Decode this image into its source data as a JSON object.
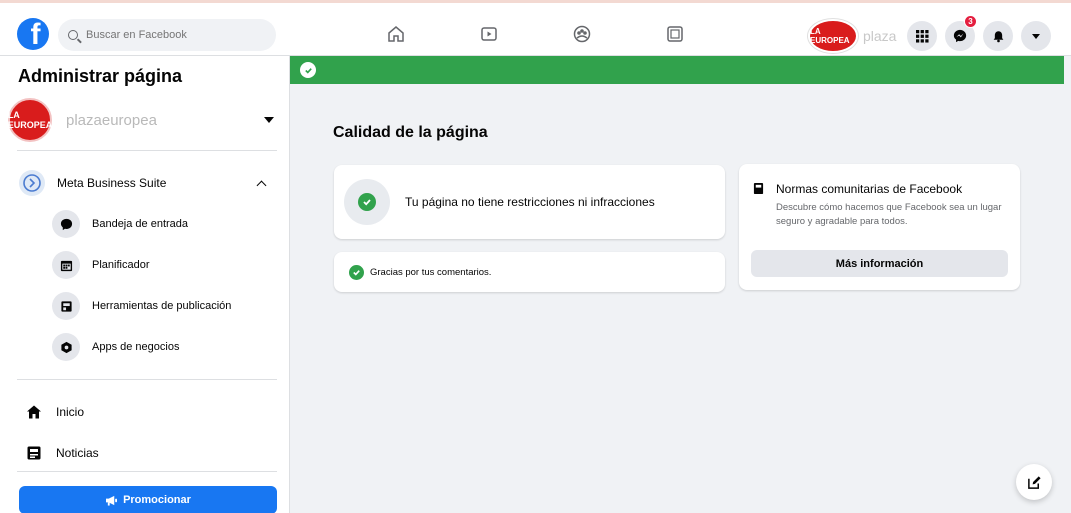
{
  "topbar": {
    "logo_icon": "facebook-logo-icon",
    "search": {
      "placeholder": "Buscar en Facebook",
      "value": ""
    },
    "nav_icons": [
      "home-icon",
      "watch-icon",
      "groups-icon",
      "gaming-icon"
    ],
    "profile": {
      "name": "plaza",
      "avatar_text": "LA EUROPEA"
    },
    "menu_icon": "grid-menu-icon",
    "messenger": {
      "icon": "messenger-icon",
      "badge": "3"
    },
    "notifications_icon": "bell-icon",
    "account_icon": "caret-down-icon"
  },
  "sidebar": {
    "title": "Administrar página",
    "page": {
      "name": "plazaeuropea",
      "avatar_text": "LA EUROPEA"
    },
    "meta_suite": {
      "label": "Meta Business Suite",
      "icon": "meta-business-suite-icon"
    },
    "sub_items": [
      {
        "label": "Bandeja de entrada",
        "icon": "inbox-icon"
      },
      {
        "label": "Planificador",
        "icon": "calendar-icon"
      },
      {
        "label": "Herramientas de publicación",
        "icon": "publishing-tools-icon"
      },
      {
        "label": "Apps de negocios",
        "icon": "business-apps-icon"
      }
    ],
    "items": [
      {
        "label": "Inicio",
        "icon": "home-icon"
      },
      {
        "label": "Noticias",
        "icon": "news-icon"
      }
    ],
    "promote_label": "Promocionar"
  },
  "main": {
    "title": "Calidad de la página",
    "status_card": {
      "text": "Tu página no tiene restricciones ni infracciones"
    },
    "feedback_card": {
      "text": "Gracias por tus comentarios."
    },
    "community_card": {
      "title": "Normas comunitarias de Facebook",
      "description": "Descubre cómo hacemos que Facebook sea un lugar seguro y agradable para todos.",
      "button": "Más información"
    }
  },
  "colors": {
    "brand_blue": "#1877f2",
    "success_green": "#31a24c",
    "badge_red": "#e41e3f"
  }
}
